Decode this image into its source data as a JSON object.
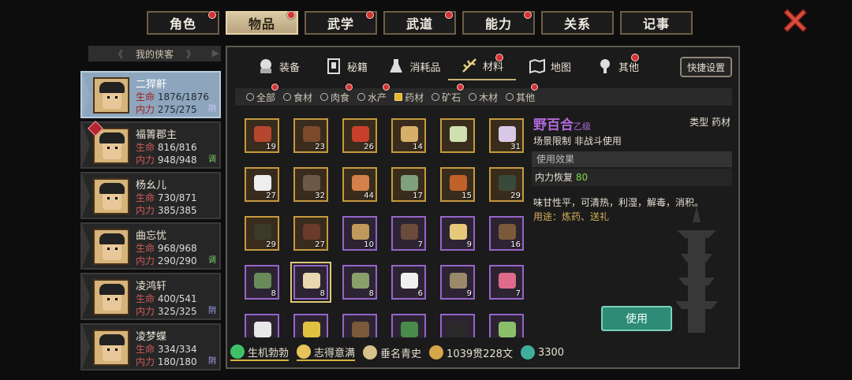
{
  "top_tabs": [
    {
      "label": "角色",
      "active": false,
      "dot": true
    },
    {
      "label": "物品",
      "active": true,
      "dot": true
    },
    {
      "label": "武学",
      "active": false,
      "dot": true
    },
    {
      "label": "武道",
      "active": false,
      "dot": true
    },
    {
      "label": "能力",
      "active": false,
      "dot": true
    },
    {
      "label": "关系",
      "active": false,
      "dot": false
    },
    {
      "label": "记事",
      "active": false,
      "dot": false
    }
  ],
  "sidebar": {
    "title": "我的侠客",
    "characters": [
      {
        "name": "二猂鼾",
        "hp_label": "生命",
        "hp": "1876/1876",
        "mp_label": "内力",
        "mp": "275/275",
        "tag": "阴",
        "tag_color": "#c8c8ff",
        "active": true,
        "badge": false
      },
      {
        "name": "福箐郡主",
        "hp_label": "生命",
        "hp": "816/816",
        "mp_label": "内力",
        "mp": "948/948",
        "tag": "调",
        "tag_color": "#7dd36a",
        "active": false,
        "badge": true
      },
      {
        "name": "杨幺儿",
        "hp_label": "生命",
        "hp": "730/871",
        "mp_label": "内力",
        "mp": "385/385",
        "tag": "",
        "tag_color": "#ccc",
        "active": false,
        "badge": false
      },
      {
        "name": "曲忘忧",
        "hp_label": "生命",
        "hp": "968/968",
        "mp_label": "内力",
        "mp": "290/290",
        "tag": "调",
        "tag_color": "#7dd36a",
        "active": false,
        "badge": false
      },
      {
        "name": "凌鸿轩",
        "hp_label": "生命",
        "hp": "400/541",
        "mp_label": "内力",
        "mp": "325/325",
        "tag": "阴",
        "tag_color": "#a8a8ff",
        "active": false,
        "badge": false
      },
      {
        "name": "凌梦蝶",
        "hp_label": "生命",
        "hp": "334/334",
        "mp_label": "内力",
        "mp": "180/180",
        "tag": "阴",
        "tag_color": "#a8a8ff",
        "active": false,
        "badge": false
      }
    ]
  },
  "sub_tabs": [
    {
      "label": "装备",
      "icon": "hat-icon",
      "active": false,
      "dot": false
    },
    {
      "label": "秘籍",
      "icon": "book-icon",
      "active": false,
      "dot": false
    },
    {
      "label": "消耗品",
      "icon": "flask-icon",
      "active": false,
      "dot": false
    },
    {
      "label": "材料",
      "icon": "herb-icon",
      "active": true,
      "dot": true
    },
    {
      "label": "地图",
      "icon": "map-icon",
      "active": false,
      "dot": false
    },
    {
      "label": "其他",
      "icon": "lamp-icon",
      "active": false,
      "dot": true
    }
  ],
  "quick_settings": "快捷设置",
  "filters": [
    {
      "label": "全部",
      "on": false,
      "dot": true
    },
    {
      "label": "食材",
      "on": false,
      "dot": false
    },
    {
      "label": "肉食",
      "on": false,
      "dot": true
    },
    {
      "label": "水产",
      "on": false,
      "dot": true
    },
    {
      "label": "药材",
      "on": true,
      "dot": false
    },
    {
      "label": "矿石",
      "on": false,
      "dot": true
    },
    {
      "label": "木材",
      "on": false,
      "dot": false
    },
    {
      "label": "其他",
      "on": false,
      "dot": true
    }
  ],
  "items": [
    {
      "qty": "19",
      "rarity": "gold",
      "color": "#b5462f"
    },
    {
      "qty": "23",
      "rarity": "gold",
      "color": "#7a4a2a"
    },
    {
      "qty": "26",
      "rarity": "gold",
      "color": "#c8402b"
    },
    {
      "qty": "14",
      "rarity": "gold",
      "color": "#d6b06a"
    },
    {
      "qty": "",
      "rarity": "gold",
      "color": "#cfe0b0"
    },
    {
      "qty": "31",
      "rarity": "gold",
      "color": "#d7c9e6"
    },
    {
      "qty": "27",
      "rarity": "gold",
      "color": "#eeeeee"
    },
    {
      "qty": "32",
      "rarity": "gold",
      "color": "#6b5a45"
    },
    {
      "qty": "44",
      "rarity": "gold",
      "color": "#d3804a"
    },
    {
      "qty": "17",
      "rarity": "gold",
      "color": "#7fa07a"
    },
    {
      "qty": "15",
      "rarity": "gold",
      "color": "#c0602a"
    },
    {
      "qty": "29",
      "rarity": "gold",
      "color": "#3a4a3a"
    },
    {
      "qty": "29",
      "rarity": "gold",
      "color": "#3a3a2a"
    },
    {
      "qty": "27",
      "rarity": "gold",
      "color": "#6a3a2a"
    },
    {
      "qty": "10",
      "rarity": "purple",
      "color": "#c09a5a"
    },
    {
      "qty": "7",
      "rarity": "purple",
      "color": "#6a4a3a"
    },
    {
      "qty": "9",
      "rarity": "purple",
      "color": "#e6c87a"
    },
    {
      "qty": "16",
      "rarity": "purple",
      "color": "#7a5a3a"
    },
    {
      "qty": "8",
      "rarity": "purple",
      "color": "#6a8a5a"
    },
    {
      "qty": "8",
      "rarity": "purple",
      "color": "#e8d7b0",
      "selected": true
    },
    {
      "qty": "8",
      "rarity": "purple",
      "color": "#8aa06a"
    },
    {
      "qty": "6",
      "rarity": "purple",
      "color": "#f0f0f0"
    },
    {
      "qty": "9",
      "rarity": "purple",
      "color": "#9a8a6a"
    },
    {
      "qty": "7",
      "rarity": "purple",
      "color": "#e06a8a"
    },
    {
      "qty": "",
      "rarity": "purple",
      "color": "#e8e8e8"
    },
    {
      "qty": "",
      "rarity": "purple",
      "color": "#e0c040"
    },
    {
      "qty": "",
      "rarity": "purple",
      "color": "#7a5a3a"
    },
    {
      "qty": "",
      "rarity": "purple",
      "color": "#4a8a4a"
    },
    {
      "qty": "",
      "rarity": "purple",
      "color": "#2a2a2a"
    },
    {
      "qty": "",
      "rarity": "purple",
      "color": "#8ac06a"
    }
  ],
  "detail": {
    "name": "野百合",
    "grade": "乙级",
    "type": "类型  药材",
    "scene": "场景限制  非战斗使用",
    "effect_header": "使用效果",
    "effect_label": "内力恢复",
    "effect_value": "80",
    "description": "味甘性平，可清热，利湿，解毒，消积。",
    "usage": "用途：炼药、送礼",
    "use_button": "使用"
  },
  "status": [
    {
      "label": "生机勃勃",
      "icon": "buff-icon",
      "color": "#3fc16a",
      "underline": true
    },
    {
      "label": "志得意满",
      "icon": "mood-icon",
      "color": "#e5c35a",
      "underline": true
    },
    {
      "label": "垂名青史",
      "icon": "fame-icon",
      "color": "#d9c18a",
      "underline": false
    },
    {
      "label": "1039贯228文",
      "icon": "coin-icon",
      "color": "#d5a64a",
      "underline": false
    },
    {
      "label": "3300",
      "icon": "jade-icon",
      "color": "#3fae9a",
      "underline": false
    }
  ]
}
